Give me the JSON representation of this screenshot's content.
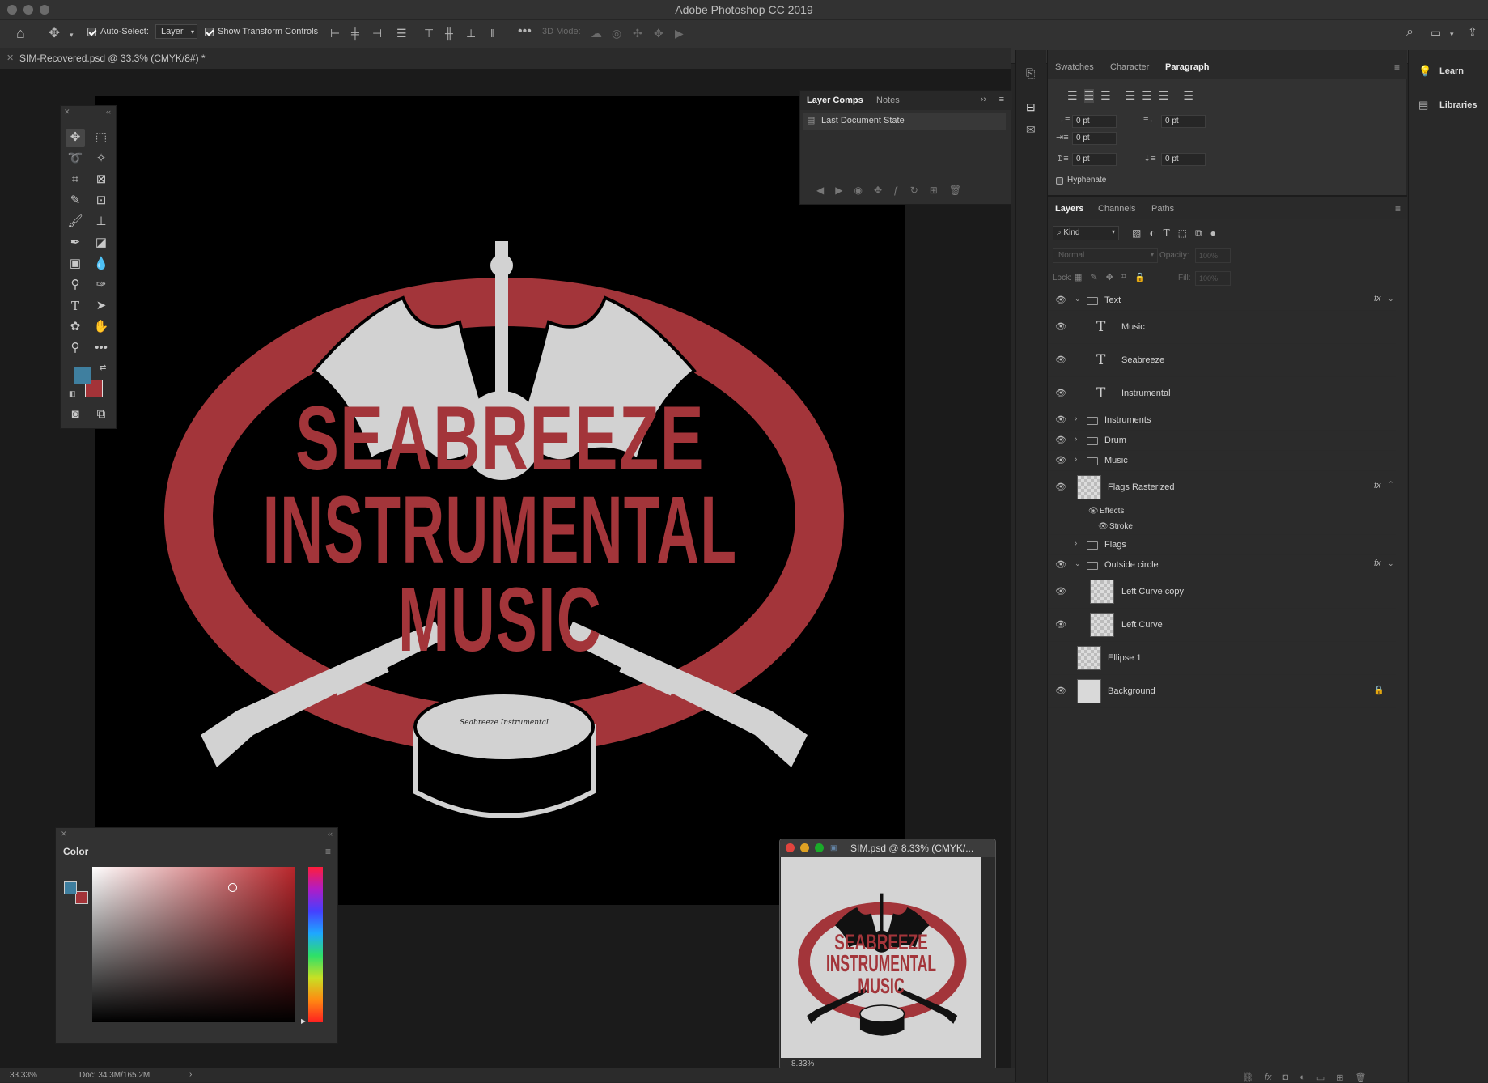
{
  "app_title": "Adobe Photoshop CC 2019",
  "options": {
    "auto_select_label": "Auto-Select:",
    "auto_select_value": "Layer",
    "show_transform_label": "Show Transform Controls",
    "mode_3d_label": "3D Mode:"
  },
  "document_tab": "SIM-Recovered.psd @ 33.3% (CMYK/8#) *",
  "logo": {
    "line1": "SEABREEZE",
    "line2": "INSTRUMENTAL",
    "line3": "MUSIC",
    "drum_text": "Seabreeze Instrumental"
  },
  "layer_comps": {
    "tabs": [
      "Layer Comps",
      "Notes"
    ],
    "item": "Last Document State"
  },
  "color_panel": {
    "title": "Color"
  },
  "thumb_window": {
    "title": "SIM.psd @ 8.33% (CMYK/...",
    "zoom": "8.33%"
  },
  "status": {
    "zoom": "33.33%",
    "doc": "Doc: 34.3M/165.2M"
  },
  "para_panel": {
    "tabs": [
      "Swatches",
      "Character",
      "Paragraph"
    ],
    "fields": [
      "0 pt",
      "0 pt",
      "0 pt",
      "0 pt",
      "0 pt"
    ],
    "hyphenate": "Hyphenate"
  },
  "layers_panel": {
    "tabs": [
      "Layers",
      "Channels",
      "Paths"
    ],
    "kind": "Kind",
    "blend_mode": "Normal",
    "opacity_label": "Opacity:",
    "opacity_value": "100%",
    "lock_label": "Lock:",
    "fill_label": "Fill:",
    "fill_value": "100%",
    "layers": {
      "text_group": "Text",
      "music_t": "Music",
      "seabreeze_t": "Seabreeze",
      "instrumental_t": "Instrumental",
      "instruments": "Instruments",
      "drum": "Drum",
      "music_g": "Music",
      "flags_rasterized": "Flags Rasterized",
      "effects": "Effects",
      "stroke": "Stroke",
      "flags": "Flags",
      "outside_circle": "Outside circle",
      "left_curve_copy": "Left Curve copy",
      "left_curve": "Left Curve",
      "ellipse": "Ellipse 1",
      "background": "Background"
    },
    "fx_symbol": "fx"
  },
  "dock": {
    "learn": "Learn",
    "libraries": "Libraries"
  },
  "colors": {
    "logo_red": "#a3353a",
    "logo_grey": "#d2d2d2",
    "fg_swatch": "#3f7f9f",
    "bg_swatch": "#a33338"
  }
}
